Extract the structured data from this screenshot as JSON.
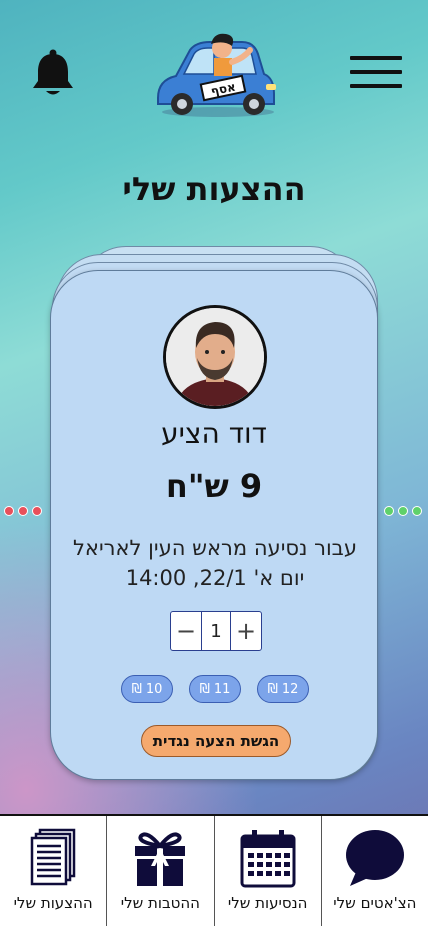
{
  "header": {
    "menu_icon": "hamburger-menu-icon",
    "notification_icon": "bell-icon",
    "logo_plate": "אסף"
  },
  "page_title": "ההצעות שלי",
  "offer_card": {
    "name": "דוד הציע",
    "price": "9 ש\"ח",
    "description_line1": "עבור נסיעה מראש העין לאריאל",
    "description_line2": "יום א' 22/1, 14:00",
    "quantity": "1",
    "quantity_minus": "−",
    "quantity_plus": "+",
    "price_options": [
      "12 ₪",
      "11 ₪",
      "10 ₪"
    ],
    "counter_offer_label": "הגשת הצעה נגדית"
  },
  "pager": {
    "left_color": "#e8505b",
    "right_color": "#5fd16a"
  },
  "bottom_nav": [
    {
      "label": "הצ'אטים שלי",
      "icon": "chat-bubble-icon"
    },
    {
      "label": "הנסיעות שלי",
      "icon": "calendar-icon"
    },
    {
      "label": "ההטבות שלי",
      "icon": "gift-icon"
    },
    {
      "label": "ההצעות שלי",
      "icon": "documents-icon"
    }
  ]
}
